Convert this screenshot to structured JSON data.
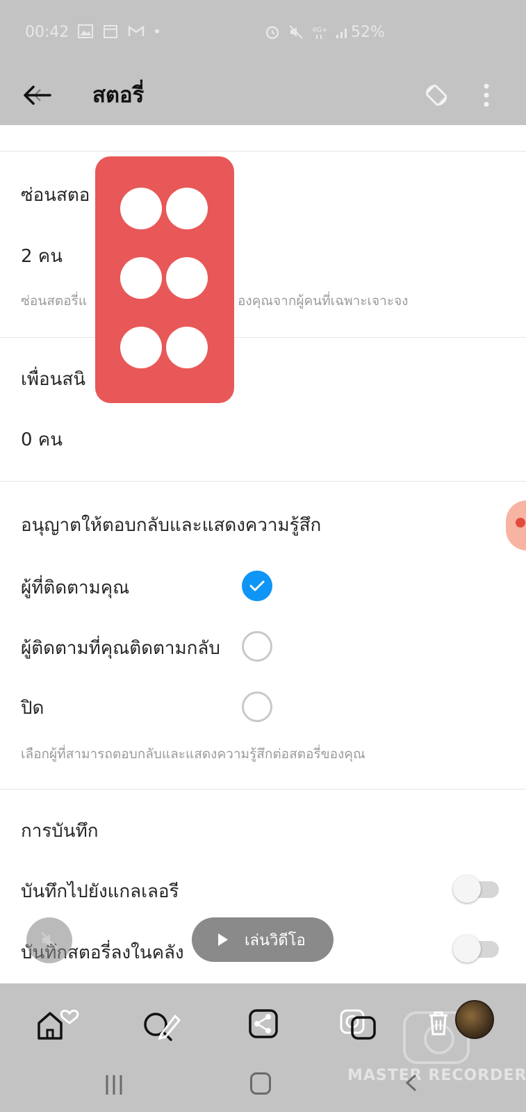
{
  "status_bar": {
    "time": "00:42",
    "battery": "52%"
  },
  "app_bar": {
    "title": "สตอรี่"
  },
  "hide_story": {
    "heading": "ซ่อนสตอ",
    "count": "2 คน",
    "hint_a": "ซ่อนสตอรี่แ",
    "hint_b": "องคุณจากผู้คนที่เฉพาะเจาะจง"
  },
  "close_friends": {
    "heading": "เพื่อนสนิ",
    "count": "0 คน"
  },
  "replies": {
    "heading": "อนุญาตให้ตอบกลับและแสดงความรู้สึก",
    "options": [
      {
        "label": "ผู้ที่ติดตามคุณ",
        "checked": true
      },
      {
        "label": "ผู้ติดตามที่คุณติดตามกลับ",
        "checked": false
      },
      {
        "label": "ปิด",
        "checked": false
      }
    ],
    "hint": "เลือกผู้ที่สามารถตอบกลับและแสดงความรู้สึกต่อสตอรี่ของคุณ"
  },
  "saving": {
    "heading": "การบันทึก",
    "items": [
      {
        "label": "บันทึกไปยังแกลเลอรี",
        "on": false
      },
      {
        "label": "บันทึกสตอรี่ลงในคลัง",
        "on": false
      }
    ]
  },
  "player": {
    "play_label": "เล่นวิดีโอ"
  },
  "watermark": "MASTER RECORDER",
  "icons": {
    "back": "back-arrow-icon",
    "rotate": "rotate-icon",
    "more": "more-vertical-icon",
    "check": "check-icon",
    "home": "home-icon",
    "heart": "heart-icon",
    "search": "search-icon",
    "pencil": "pencil-icon",
    "share": "share-icon",
    "camera": "camera-icon",
    "trash": "trash-icon",
    "mute": "mute-icon",
    "play": "play-icon"
  },
  "colors": {
    "bars": "#c3c3c3",
    "accent_blue": "#0f95f5",
    "grip_red": "#e85858"
  }
}
